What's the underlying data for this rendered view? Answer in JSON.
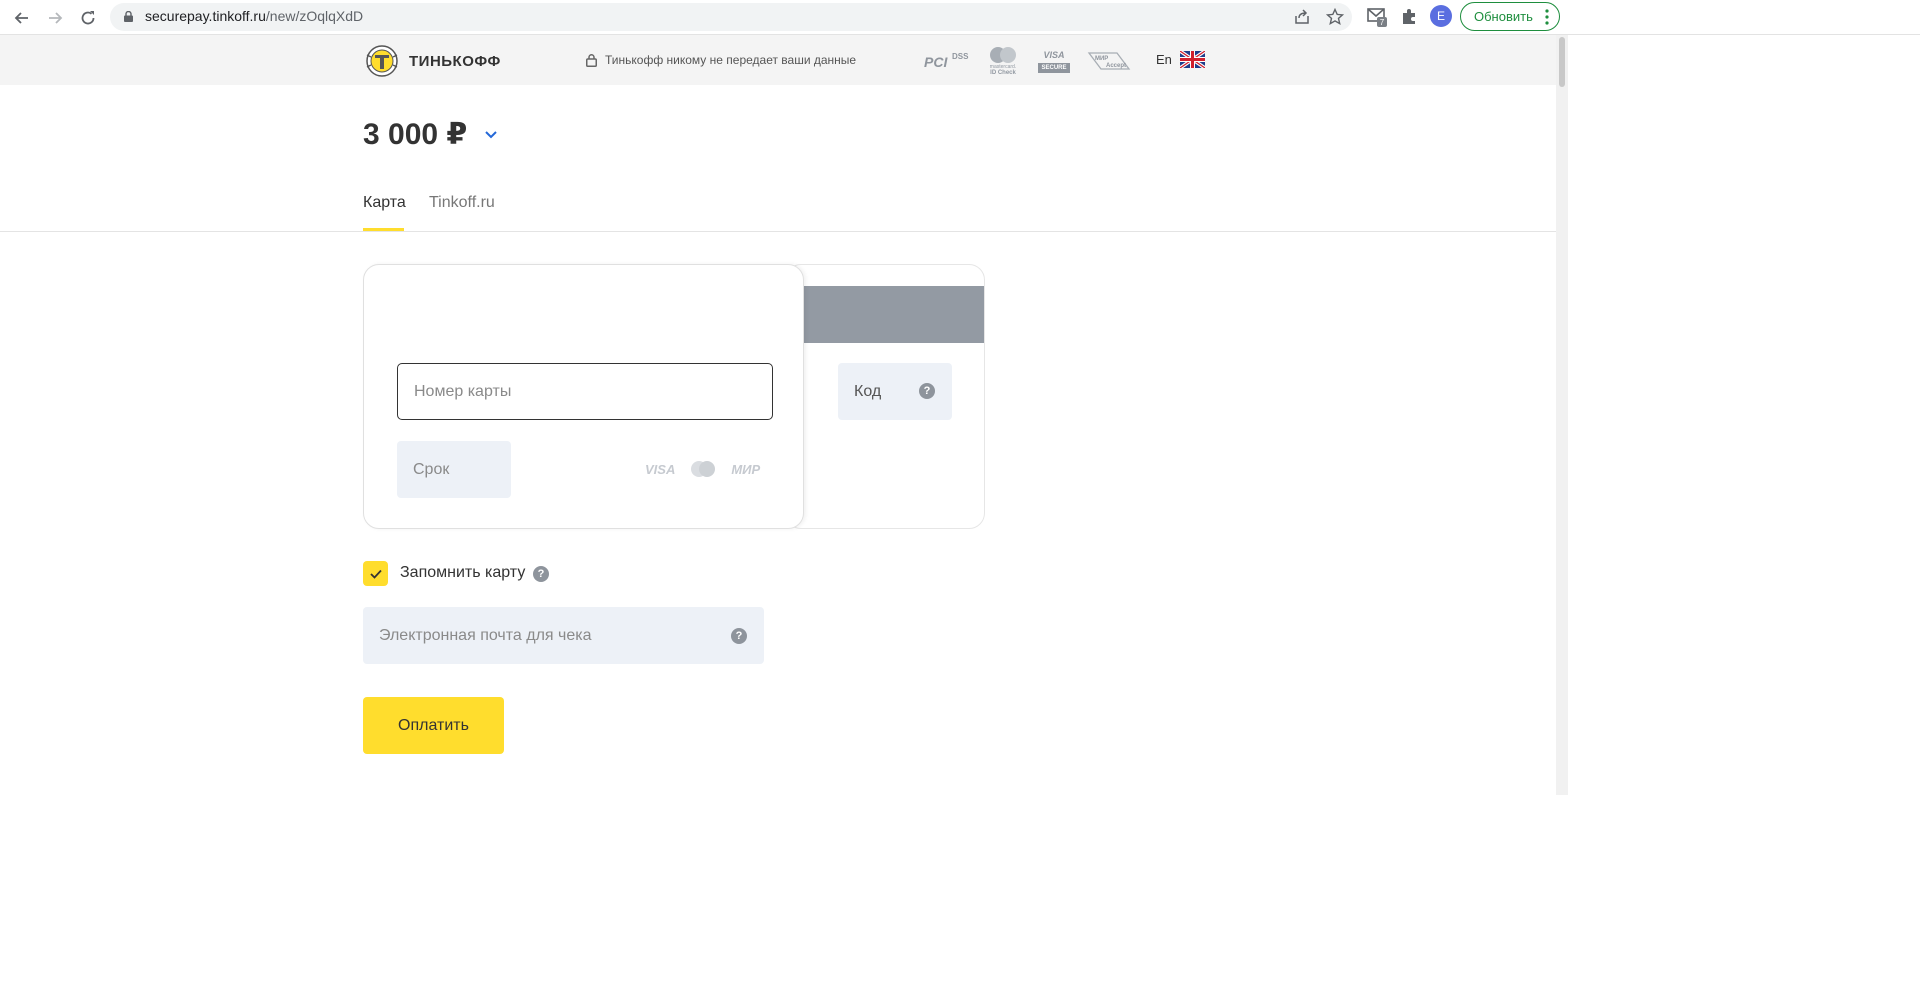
{
  "browser": {
    "url_host": "securepay.tinkoff.ru",
    "url_path": "/new/zOqlqXdD",
    "avatar_letter": "E",
    "update_label": "Обновить",
    "extension_badge": "7"
  },
  "header": {
    "brand": "ТИНЬКОФФ",
    "privacy_text": "Тинькофф никому не передает ваши данные",
    "badges": {
      "pci": "PCI",
      "dss": "DSS",
      "mc_line1": "mastercard.",
      "mc_line2": "ID Check",
      "visa": "VISA",
      "visa_secure": "SECURE",
      "mir": "МИР",
      "mir_accept": "Accept"
    },
    "language": "En"
  },
  "payment": {
    "amount": "3 000 ₽"
  },
  "tabs": [
    {
      "label": "Карта",
      "active": true
    },
    {
      "label": "Tinkoff.ru",
      "active": false
    }
  ],
  "card_form": {
    "card_number_placeholder": "Номер карты",
    "expiry_placeholder": "Срок",
    "cvc_placeholder": "Код",
    "help_symbol": "?",
    "logos": {
      "visa": "VISA",
      "mir": "МИР"
    }
  },
  "remember": {
    "label": "Запомнить карту",
    "checked": true
  },
  "email": {
    "placeholder": "Электронная почта для чека"
  },
  "pay_button": {
    "label": "Оплатить"
  },
  "colors": {
    "accent": "#ffdd2d",
    "field_bg": "#edf1f7",
    "stripe": "#939aa3"
  }
}
